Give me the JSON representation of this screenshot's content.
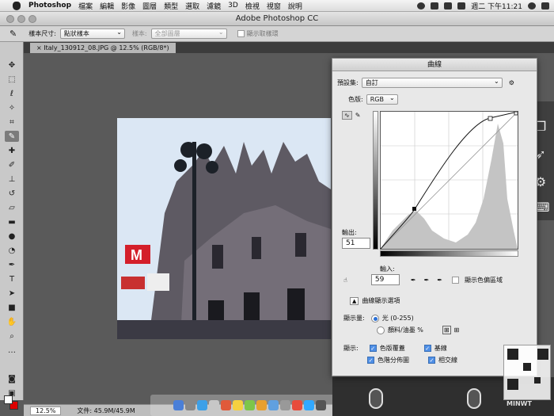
{
  "menubar": {
    "app": "Photoshop",
    "items": [
      "檔案",
      "編輯",
      "影像",
      "圖層",
      "類型",
      "選取",
      "濾鏡",
      "3D",
      "檢視",
      "視窗",
      "說明"
    ],
    "clock": "週二 下午11:21"
  },
  "window": {
    "title": "Adobe Photoshop CC"
  },
  "options": {
    "sample_size_label": "樣本尺寸:",
    "sample_size_value": "點狀樣本",
    "sample_label": "樣本:",
    "sample_value": "全部圖層",
    "show_ring_label": "顯示取樣環"
  },
  "document": {
    "tab": "Italy_130912_08.JPG @ 12.5% (RGB/8*)"
  },
  "status": {
    "zoom": "12.5%",
    "file": "文件: 45.9M/45.9M"
  },
  "curves": {
    "title": "曲線",
    "preset_label": "預設集:",
    "preset_value": "自訂",
    "channel_label": "色版:",
    "channel_value": "RGB",
    "output_label": "輸出:",
    "output_value": "51",
    "input_label": "輸入:",
    "input_value": "59",
    "show_clipping": "顯示色偏區域",
    "display_options": "曲線顯示選項",
    "show_amount_label": "顯示量:",
    "light_option": "光 (0-255)",
    "pigment_option": "顏料/油墨 %",
    "show_label": "顯示:",
    "channel_overlays": "色版覆蓋",
    "baseline": "基線",
    "histogram": "色階分佈圖",
    "intersection": "相交線"
  },
  "colors": {
    "accent": "#2a6fd6",
    "foreground": "#ffffff",
    "background": "#dd0000"
  },
  "watermark": "MINWT"
}
